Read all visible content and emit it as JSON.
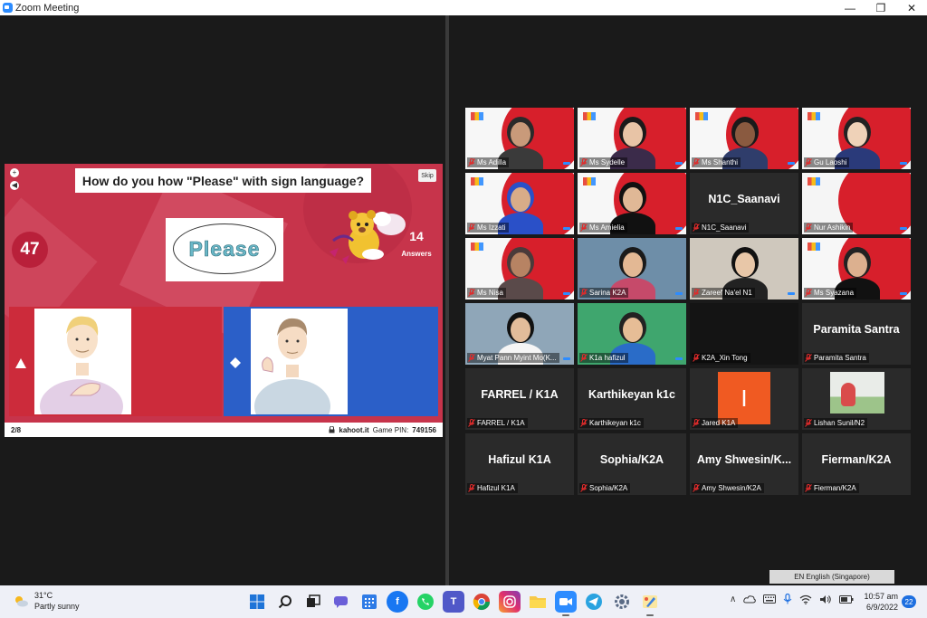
{
  "window": {
    "title": "Zoom Meeting",
    "minimize": "—",
    "restore": "❐",
    "close": "✕"
  },
  "slide": {
    "question": "How do you how \"Please\" with sign language?",
    "skip_label": "Skip",
    "timer": "47",
    "answers_count": "14",
    "answers_label": "Answers",
    "card_word": "Please",
    "progress": "2/8",
    "site": "kahoot.it",
    "pin_label": "Game PIN:",
    "pin_value": "749156",
    "colors": {
      "red": "#cc2b3b",
      "blue": "#2b5fc8",
      "bg": "#c7344b"
    }
  },
  "gallery": {
    "tiles": [
      {
        "name": "Ms Adilla"
      },
      {
        "name": "Ms Sydelle"
      },
      {
        "name": "Ms Shanthi"
      },
      {
        "name": "Gu Laoshi"
      },
      {
        "name": "Ms Izzati"
      },
      {
        "name": "Ms Amielia"
      },
      {
        "name": "N1C_Saanavi",
        "display": "N1C_Saanavi"
      },
      {
        "name": "Nur Ashikin"
      },
      {
        "name": "Ms Nisa"
      },
      {
        "name": "Sarina K2A"
      },
      {
        "name": "Zareef Na'el N1"
      },
      {
        "name": "Ms Syazana"
      },
      {
        "name": "Myat Pann Myint Mo(K..."
      },
      {
        "name": "K1a hafizul"
      },
      {
        "name": "K2A_Xin Tong"
      },
      {
        "name": "Paramita Santra",
        "display": "Paramita Santra"
      },
      {
        "name": "FARREL / K1A",
        "display": "FARREL / K1A"
      },
      {
        "name": "Karthikeyan k1c",
        "display": "Karthikeyan k1c"
      },
      {
        "name": "Jared K1A",
        "avatar_letter": "I"
      },
      {
        "name": "Lishan Sunil/N2"
      },
      {
        "name": "Hafizul K1A",
        "display": "Hafizul K1A"
      },
      {
        "name": "Sophia/K2A",
        "display": "Sophia/K2A"
      },
      {
        "name": "Amy Shwesin/K2A",
        "display": "Amy  Shwesin/K..."
      },
      {
        "name": "Fierman/K2A",
        "display": "Fierman/K2A"
      }
    ]
  },
  "language_bar": {
    "label": "EN English (Singapore)"
  },
  "taskbar": {
    "weather_temp": "31°C",
    "weather_desc": "Partly sunny",
    "time": "10:57 am",
    "date": "6/9/2022",
    "notifications": "22",
    "tray_chevron": "∧"
  }
}
